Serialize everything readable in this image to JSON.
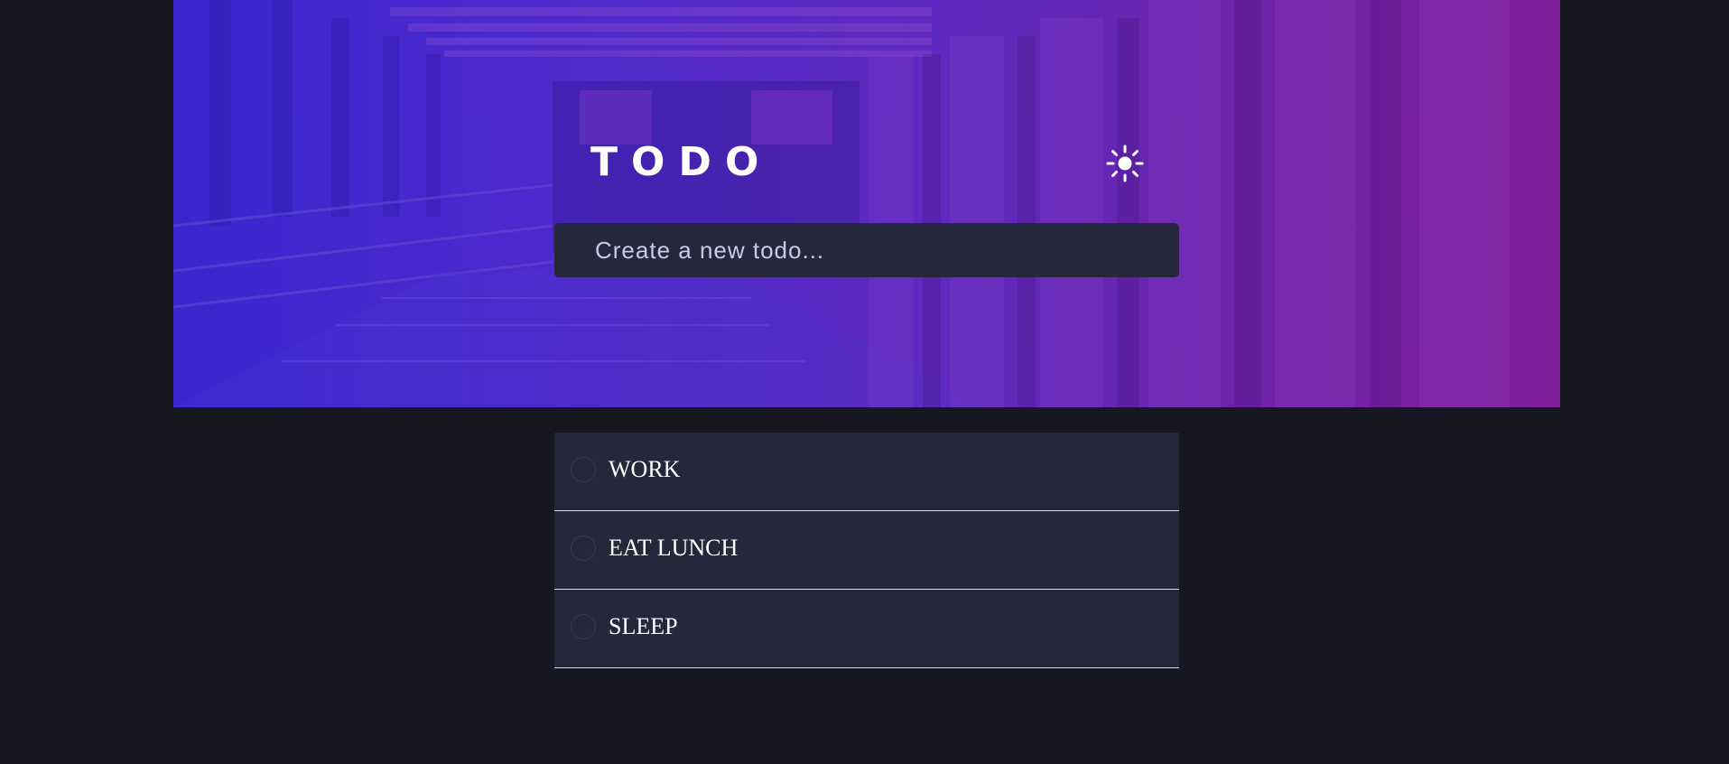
{
  "app": {
    "title": "TODO",
    "theme_toggle_icon": "sun-icon"
  },
  "new_todo": {
    "placeholder": "Create a new todo...",
    "value": ""
  },
  "todos": [
    {
      "text": "WORK",
      "completed": false
    },
    {
      "text": "EAT LUNCH",
      "completed": false
    },
    {
      "text": "SLEEP",
      "completed": false
    }
  ],
  "colors": {
    "page_background": "#171722",
    "card_background": "#25273c",
    "hero_gradient_start": "#3a22c9",
    "hero_gradient_end": "#7a1e96",
    "text": "#ffffff",
    "placeholder": "#c8cbe7",
    "divider": "#dcdce8"
  }
}
